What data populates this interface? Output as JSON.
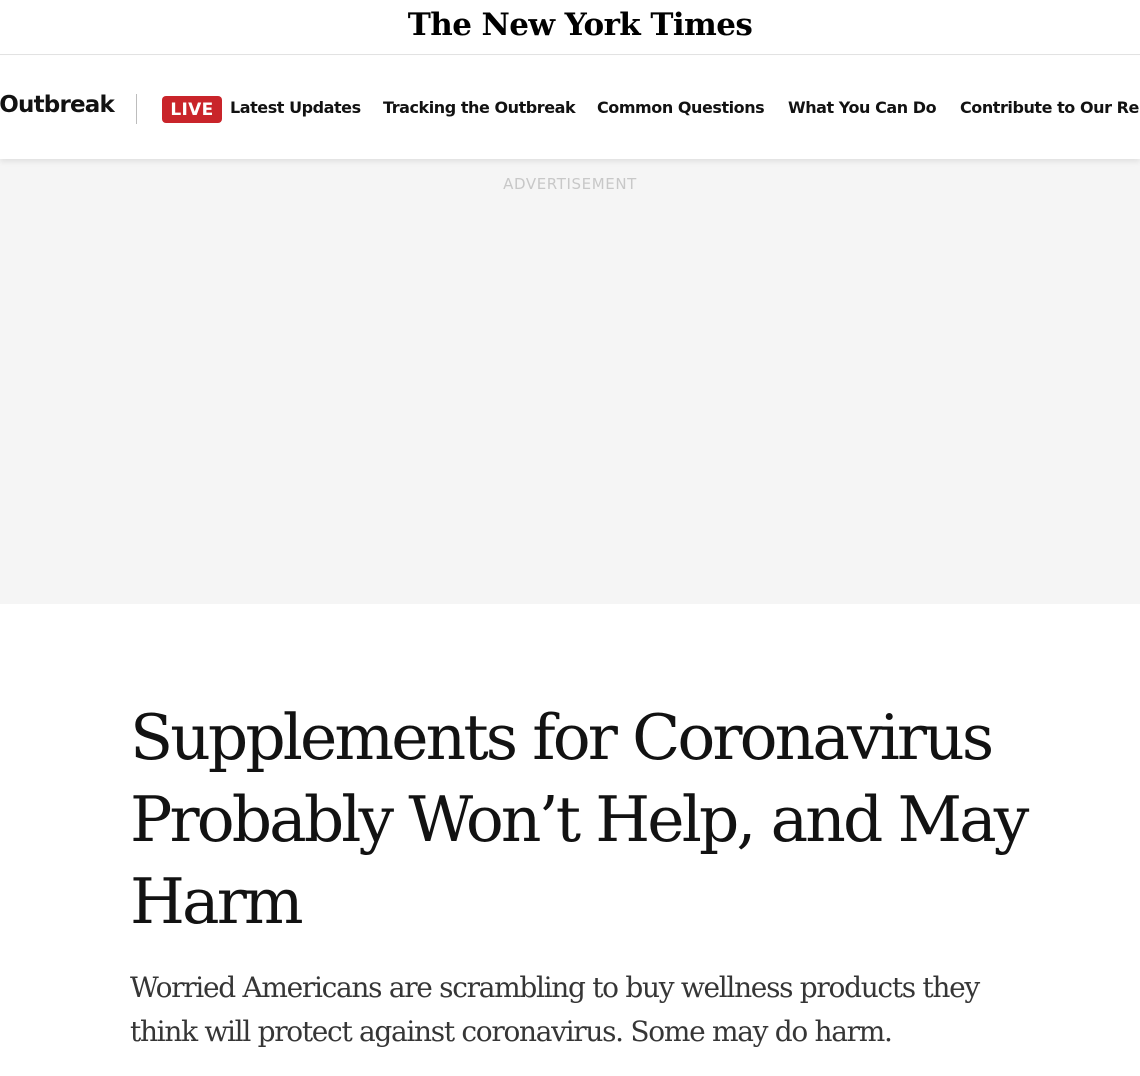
{
  "masthead": {
    "logo_text": "The New York Times"
  },
  "section_nav": {
    "section_title": "Coronavirus Outbreak",
    "live_badge": "LIVE",
    "links": [
      "Latest Updates",
      "Tracking the Outbreak",
      "Common Questions",
      "What You Can Do",
      "Contribute to Our Reporting"
    ]
  },
  "ad": {
    "label": "ADVERTISEMENT"
  },
  "article": {
    "headline": "Supplements for Coronavirus Probably Won’t Help, and May Harm",
    "summary": "Worried Americans are scrambling to buy wellness products they think will protect against coronavirus. Some may do harm."
  },
  "colors": {
    "live_badge": "#c9242a",
    "ad_background": "#f5f5f5",
    "text": "#121212"
  }
}
